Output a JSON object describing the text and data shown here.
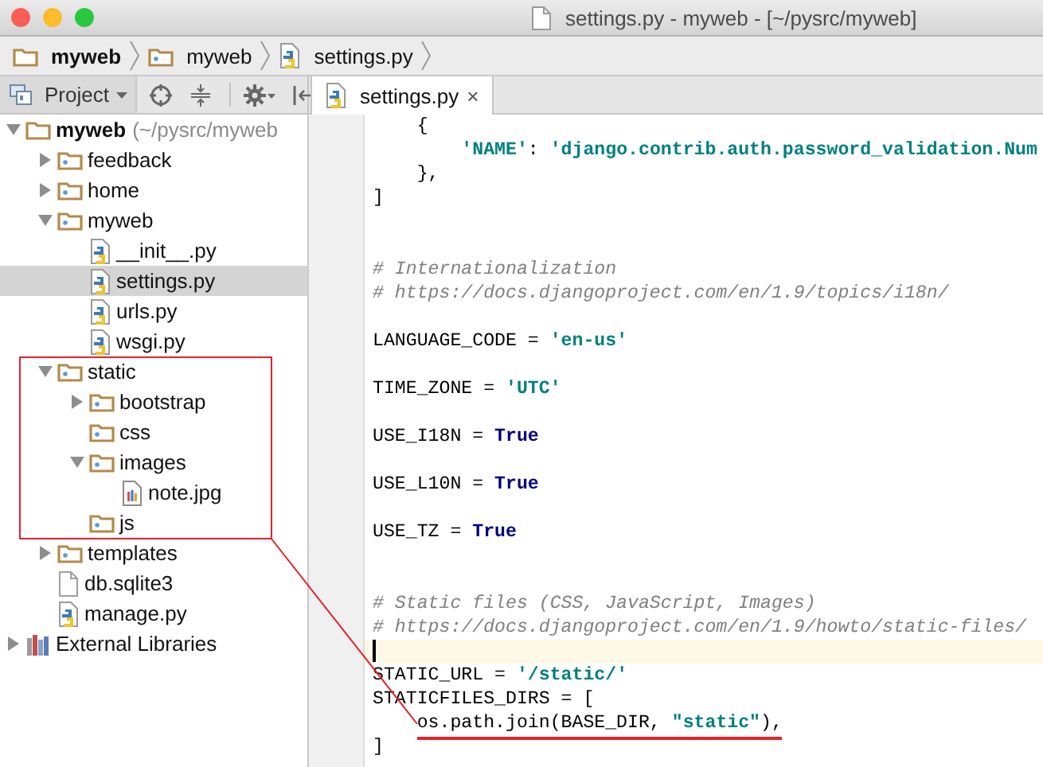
{
  "window": {
    "title": "settings.py - myweb - [~/pysrc/myweb]"
  },
  "breadcrumbs": [
    {
      "label": "myweb",
      "kind": "project"
    },
    {
      "label": "myweb",
      "kind": "package"
    },
    {
      "label": "settings.py",
      "kind": "python"
    }
  ],
  "project_panel": {
    "view": "Project",
    "tree": [
      {
        "label": "myweb",
        "note": "(~/pysrc/myweb",
        "kind": "project",
        "expanded": true,
        "selected": false,
        "children": [
          {
            "label": "feedback",
            "kind": "package",
            "expanded": false,
            "selected": false
          },
          {
            "label": "home",
            "kind": "package",
            "expanded": false,
            "selected": false
          },
          {
            "label": "myweb",
            "kind": "package",
            "expanded": true,
            "selected": false,
            "children": [
              {
                "label": "__init__.py",
                "kind": "python",
                "selected": false
              },
              {
                "label": "settings.py",
                "kind": "python",
                "selected": true
              },
              {
                "label": "urls.py",
                "kind": "python",
                "selected": false
              },
              {
                "label": "wsgi.py",
                "kind": "python",
                "selected": false
              }
            ]
          },
          {
            "label": "static",
            "kind": "package",
            "expanded": true,
            "selected": false,
            "framed": true,
            "children": [
              {
                "label": "bootstrap",
                "kind": "package",
                "expanded": false,
                "selected": false
              },
              {
                "label": "css",
                "kind": "package",
                "selected": false
              },
              {
                "label": "images",
                "kind": "package",
                "expanded": true,
                "selected": false,
                "children": [
                  {
                    "label": "note.jpg",
                    "kind": "image",
                    "selected": false
                  }
                ]
              },
              {
                "label": "js",
                "kind": "package",
                "selected": false
              }
            ]
          },
          {
            "label": "templates",
            "kind": "package",
            "expanded": false,
            "selected": false
          },
          {
            "label": "db.sqlite3",
            "kind": "file",
            "selected": false
          },
          {
            "label": "manage.py",
            "kind": "python",
            "selected": false
          }
        ]
      },
      {
        "label": "External Libraries",
        "kind": "library",
        "expanded": false,
        "selected": false
      }
    ]
  },
  "tabs": [
    {
      "label": "settings.py",
      "selected": true,
      "close": "×"
    }
  ],
  "editor": {
    "lines": [
      {
        "kind": "code",
        "segments": [
          {
            "text": "    {",
            "kind": "plain"
          }
        ]
      },
      {
        "kind": "code",
        "segments": [
          {
            "text": "        'NAME'",
            "kind": "string"
          },
          {
            "text": ": ",
            "kind": "plain"
          },
          {
            "text": "'django.contrib.auth.password_validation.Num",
            "kind": "string"
          }
        ]
      },
      {
        "kind": "code",
        "segments": [
          {
            "text": "    },",
            "kind": "plain"
          }
        ]
      },
      {
        "kind": "code",
        "segments": [
          {
            "text": "]",
            "kind": "plain"
          }
        ]
      },
      {
        "kind": "blank"
      },
      {
        "kind": "blank"
      },
      {
        "kind": "code",
        "segments": [
          {
            "text": "# Internationalization",
            "kind": "comment"
          }
        ]
      },
      {
        "kind": "code",
        "segments": [
          {
            "text": "# https://docs.djangoproject.com/en/1.9/topics/i18n/",
            "kind": "comment"
          }
        ]
      },
      {
        "kind": "blank"
      },
      {
        "kind": "code",
        "segments": [
          {
            "text": "LANGUAGE_CODE = ",
            "kind": "plain"
          },
          {
            "text": "'en-us'",
            "kind": "string"
          }
        ]
      },
      {
        "kind": "blank"
      },
      {
        "kind": "code",
        "segments": [
          {
            "text": "TIME_ZONE = ",
            "kind": "plain"
          },
          {
            "text": "'UTC'",
            "kind": "string"
          }
        ]
      },
      {
        "kind": "blank"
      },
      {
        "kind": "code",
        "segments": [
          {
            "text": "USE_I18N = ",
            "kind": "plain"
          },
          {
            "text": "True",
            "kind": "keyword"
          }
        ]
      },
      {
        "kind": "blank"
      },
      {
        "kind": "code",
        "segments": [
          {
            "text": "USE_L10N = ",
            "kind": "plain"
          },
          {
            "text": "True",
            "kind": "keyword"
          }
        ]
      },
      {
        "kind": "blank"
      },
      {
        "kind": "code",
        "segments": [
          {
            "text": "USE_TZ = ",
            "kind": "plain"
          },
          {
            "text": "True",
            "kind": "keyword"
          }
        ]
      },
      {
        "kind": "blank"
      },
      {
        "kind": "blank"
      },
      {
        "kind": "code",
        "segments": [
          {
            "text": "# Static files (CSS, JavaScript, Images)",
            "kind": "comment"
          }
        ]
      },
      {
        "kind": "code",
        "segments": [
          {
            "text": "# https://docs.djangoproject.com/en/1.9/howto/static-files/",
            "kind": "comment"
          }
        ]
      },
      {
        "kind": "caret"
      },
      {
        "kind": "code",
        "segments": [
          {
            "text": "STATIC_URL = ",
            "kind": "plain"
          },
          {
            "text": "'/static/'",
            "kind": "string"
          }
        ]
      },
      {
        "kind": "code",
        "segments": [
          {
            "text": "STATICFILES_DIRS = [",
            "kind": "plain"
          }
        ]
      },
      {
        "kind": "code",
        "underlined": true,
        "segments": [
          {
            "text": "    os.path.join(BASE_DIR, ",
            "kind": "plain"
          },
          {
            "text": "\"static\"",
            "kind": "string"
          },
          {
            "text": "),",
            "kind": "plain"
          }
        ]
      },
      {
        "kind": "code",
        "segments": [
          {
            "text": "]",
            "kind": "plain"
          }
        ]
      }
    ]
  },
  "leader_line": true
}
